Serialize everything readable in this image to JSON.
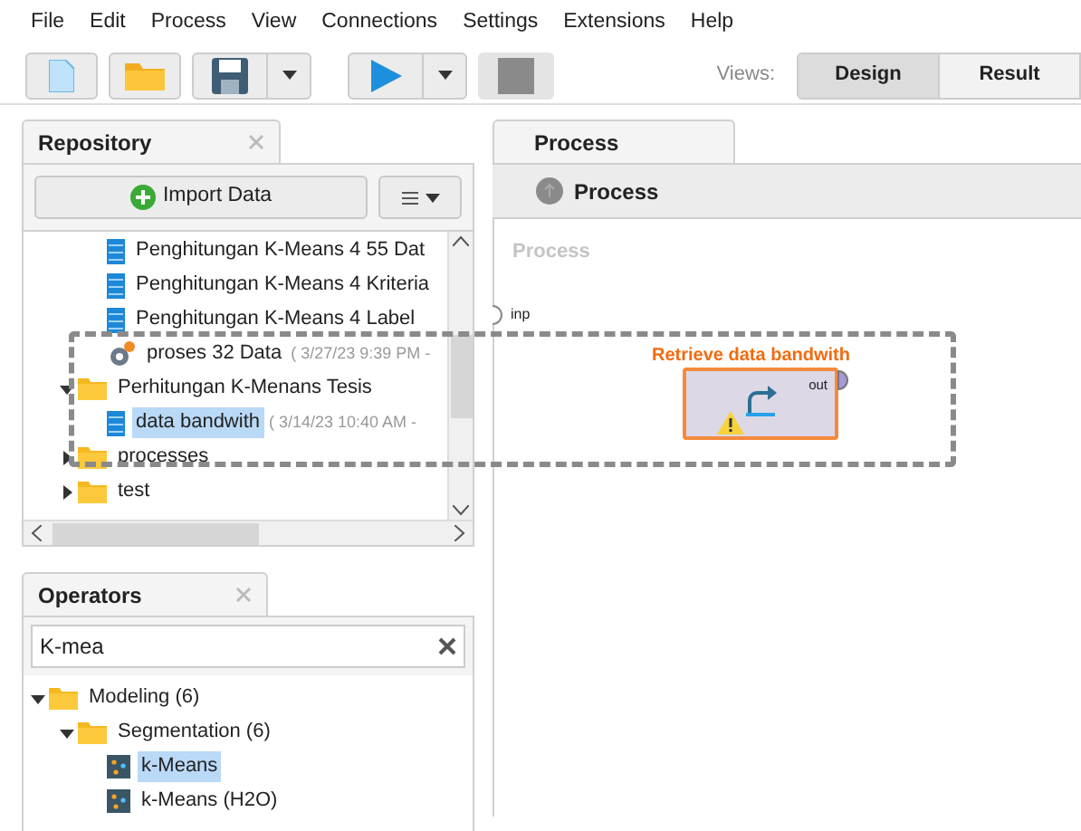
{
  "menu": [
    "File",
    "Edit",
    "Process",
    "View",
    "Connections",
    "Settings",
    "Extensions",
    "Help"
  ],
  "views": {
    "label": "Views:",
    "tabs": [
      {
        "label": "Design",
        "selected": true
      },
      {
        "label": "Result",
        "selected": false
      }
    ]
  },
  "repository": {
    "tab": "Repository",
    "import_button": "Import Data",
    "continued": [
      {
        "kind": "data",
        "name": "Penghitungan K-Means 4 55 Dat",
        "selected": false
      },
      {
        "kind": "data",
        "name": "Penghitungan K-Means 4 Kriteria",
        "selected": false
      },
      {
        "kind": "data",
        "name": "Penghitungan K-Means 4 Label",
        "selected": false
      },
      {
        "kind": "process",
        "name": "proses 32 Data",
        "meta": "( 3/27/23 9:39 PM -",
        "selected": false
      }
    ],
    "items": [
      {
        "kind": "folder",
        "name": "Perhitungan K-Menans  Tesis",
        "expanded": true,
        "selected": false,
        "children": [
          {
            "kind": "data",
            "name": "data bandwith",
            "meta": "( 3/14/23 10:40 AM -",
            "selected": true
          }
        ]
      },
      {
        "kind": "folder",
        "name": "processes",
        "expanded": false,
        "selected": false
      },
      {
        "kind": "folder",
        "name": "test",
        "expanded": false,
        "selected": false
      }
    ]
  },
  "operators": {
    "tab": "Operators",
    "search": "K-mea",
    "items": [
      {
        "kind": "folder",
        "name": "Modeling (6)",
        "expanded": true,
        "selected": false,
        "children": [
          {
            "kind": "folder",
            "name": "Segmentation (6)",
            "expanded": true,
            "selected": false,
            "children": [
              {
                "kind": "operator",
                "name": "k-Means",
                "selected": true
              },
              {
                "kind": "operator",
                "name": "k-Means (H2O)",
                "selected": false
              }
            ]
          }
        ]
      }
    ]
  },
  "process": {
    "tab": "Process",
    "breadcrumb": "Process",
    "canvas_label": "Process",
    "input_port": "inp",
    "operator": {
      "title": "Retrieve data bandwith",
      "output_port": "out",
      "warning": true
    }
  }
}
